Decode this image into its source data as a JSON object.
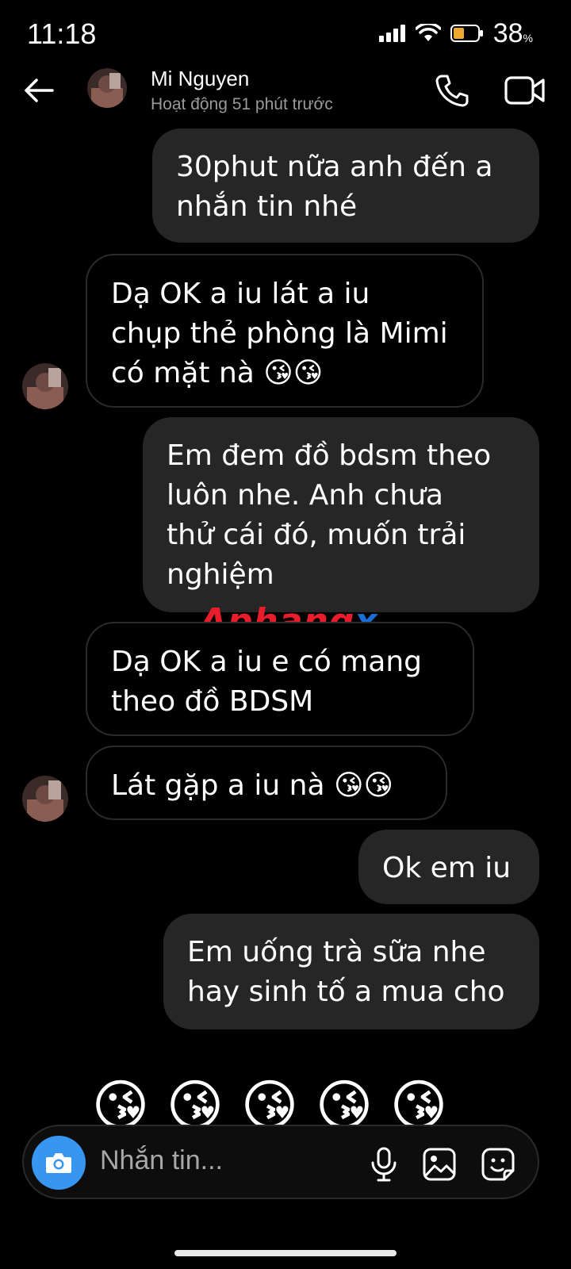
{
  "status_bar": {
    "time": "11:18",
    "battery_percent": "38",
    "battery_unit": "%"
  },
  "header": {
    "contact_name": "Mi Nguyen",
    "activity_status": "Hoạt động 51 phút trước",
    "icons": [
      "back-arrow-icon",
      "phone-icon",
      "video-camera-icon"
    ]
  },
  "messages": [
    {
      "sender": "me",
      "text": "30phut nữa anh đến a\nnhắn tin nhé"
    },
    {
      "sender": "contact",
      "text": "Dạ OK a iu lát a iu\nchụp thẻ phòng là Mimi\ncó mặt nà 😘😘"
    },
    {
      "sender": "me",
      "text": "Em đem đồ bdsm theo\nluôn nhe. Anh chưa\nthử cái đó, muốn trải\nnghiệm"
    },
    {
      "sender": "contact",
      "text": "Dạ OK a iu e có mang\ntheo đồ BDSM"
    },
    {
      "sender": "contact",
      "text": "Lát gặp a iu nà 😘😘"
    },
    {
      "sender": "me",
      "text": "Ok em iu"
    },
    {
      "sender": "me",
      "text": "Em uống trà sữa nhe\nhay sinh tố a mua cho"
    }
  ],
  "emoji_message": [
    "😘",
    "😘",
    "😘",
    "😘",
    "😘"
  ],
  "watermark": {
    "part1": "Aphang",
    "part2": "x"
  },
  "composer": {
    "placeholder": "Nhắn tin...",
    "icons": [
      "camera-icon",
      "microphone-icon",
      "gallery-icon",
      "sticker-icon"
    ]
  },
  "colors": {
    "background": "#000000",
    "bubble_outgoing": "#262626",
    "bubble_incoming_border": "#2a2a2a",
    "camera_button": "#3797f0",
    "secondary_text": "#9a9a9a"
  }
}
